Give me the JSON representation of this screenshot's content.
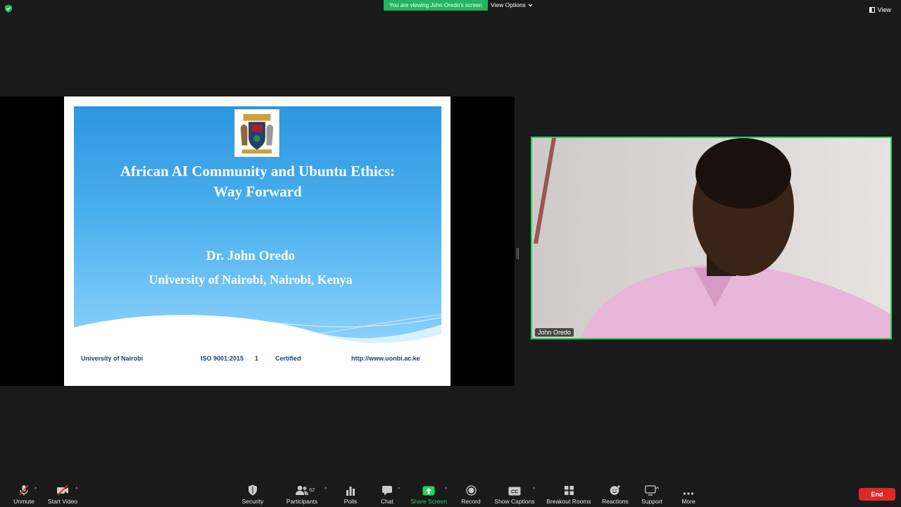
{
  "top_bar": {
    "viewing_banner": "You are viewing John Oredo's screen",
    "view_options": "View Options",
    "view_button": "View"
  },
  "slide": {
    "title_line1": "African AI Community and Ubuntu Ethics:",
    "title_line2": "Way Forward",
    "author": "Dr. John Oredo",
    "affiliation": "University of Nairobi, Nairobi, Kenya",
    "footer": {
      "university": "University of Nairobi",
      "iso": "ISO 9001:2015",
      "page_number": "1",
      "certified": "Certified",
      "url": "http://www.uonbi.ac.ke"
    }
  },
  "participant": {
    "name": "John Oredo"
  },
  "toolbar": {
    "unmute": "Unmute",
    "start_video": "Start Video",
    "security": "Security",
    "participants": "Participants",
    "participants_count": "62",
    "polls": "Polls",
    "chat": "Chat",
    "share_screen": "Share Screen",
    "record": "Record",
    "show_captions": "Show Captions",
    "breakout_rooms": "Breakout Rooms",
    "reactions": "Reactions",
    "support": "Support",
    "more": "More",
    "end": "End"
  },
  "colors": {
    "active_green": "#23b45e",
    "speaker_border": "#23d160",
    "end_red": "#e02828",
    "background": "#1a1a1a"
  }
}
